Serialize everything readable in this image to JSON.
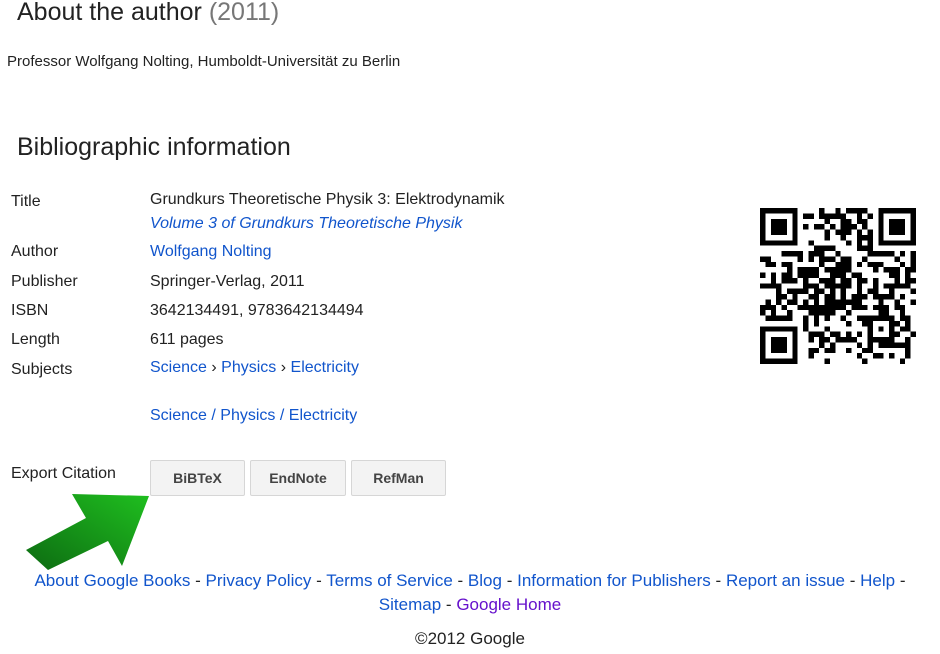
{
  "about": {
    "heading": "About the author",
    "year": "(2011)",
    "text": "Professor Wolfgang Nolting, Humboldt-Universität zu Berlin"
  },
  "biblio": {
    "heading": "Bibliographic information",
    "title_label": "Title",
    "title": "Grundkurs Theoretische Physik 3: Elektrodynamik",
    "series": "Volume 3 of Grundkurs Theoretische Physik",
    "author_label": "Author",
    "author": "Wolfgang Nolting",
    "publisher_label": "Publisher",
    "publisher": "Springer-Verlag, 2011",
    "isbn_label": "ISBN",
    "isbn": "3642134491, 9783642134494",
    "length_label": "Length",
    "length": "611 pages",
    "subjects_label": "Subjects",
    "subjects": [
      "Science",
      "Physics",
      "Electricity"
    ],
    "subjects_sep1": "›",
    "subjects2": [
      "Science",
      "Physics",
      "Electricity"
    ],
    "subjects2_sep": "/"
  },
  "export": {
    "label": "Export Citation",
    "buttons": [
      "BiBTeX",
      "EndNote",
      "RefMan"
    ]
  },
  "footer": {
    "links": [
      "About Google Books",
      "Privacy Policy",
      "Terms of Service",
      "Blog",
      "Information for Publishers",
      "Report an issue",
      "Help",
      "Sitemap",
      "Google Home"
    ],
    "sep": "-",
    "copyright": "©2012 Google"
  },
  "colors": {
    "link": "#1155cc",
    "visited": "#6611cc",
    "arrow": "#1a9c1a"
  },
  "icons": {
    "qr": "qr-code-icon",
    "arrow": "green-arrow-icon"
  }
}
